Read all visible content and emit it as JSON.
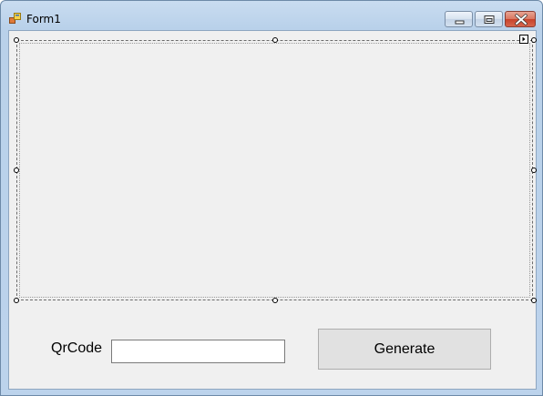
{
  "window": {
    "title": "Form1",
    "icon": "form-app-icon",
    "controls": {
      "minimize_icon": "minimize-icon",
      "maximize_icon": "restore-icon",
      "close_icon": "close-icon"
    },
    "close_color": "#c7432b"
  },
  "form": {
    "picture_box": {
      "selected": true
    },
    "qrcode_label": "QrCode",
    "qrcode_input": {
      "value": "",
      "placeholder": ""
    },
    "generate_button": "Generate"
  }
}
